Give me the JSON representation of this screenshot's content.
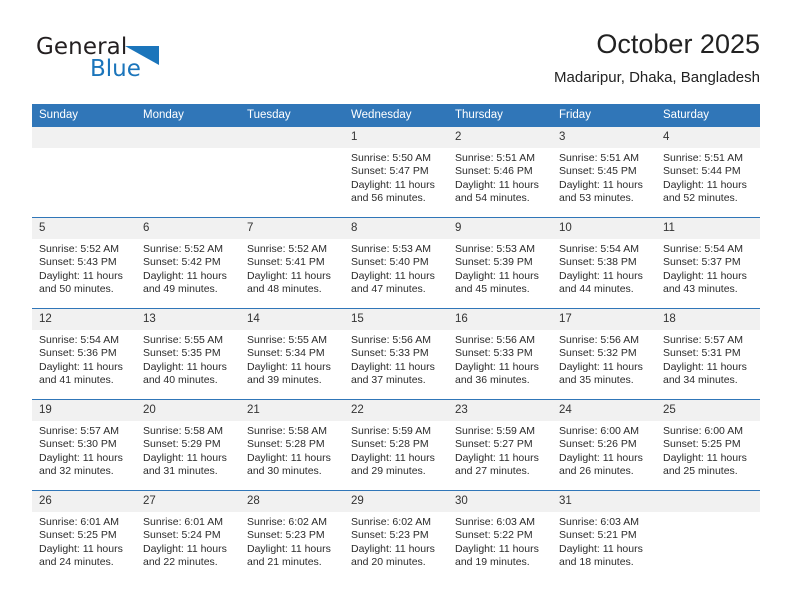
{
  "brand": {
    "name_part1": "General",
    "name_part2": "Blue",
    "triangle_color": "#1b75bb"
  },
  "header": {
    "title": "October 2025",
    "subtitle": "Madaripur, Dhaka, Bangladesh"
  },
  "theme": {
    "header_blue": "#3076b8",
    "daynum_band": "#f1f1f1",
    "text": "#2b2b2b"
  },
  "labels": {
    "sunrise_prefix": "Sunrise:",
    "sunset_prefix": "Sunset:",
    "daylight_prefix": "Daylight:"
  },
  "weekdays": [
    "Sunday",
    "Monday",
    "Tuesday",
    "Wednesday",
    "Thursday",
    "Friday",
    "Saturday"
  ],
  "weeks": [
    [
      {
        "day": "",
        "sunrise": "",
        "sunset": "",
        "daylight_line1": "",
        "daylight_line2": "",
        "empty": true
      },
      {
        "day": "",
        "sunrise": "",
        "sunset": "",
        "daylight_line1": "",
        "daylight_line2": "",
        "empty": true
      },
      {
        "day": "",
        "sunrise": "",
        "sunset": "",
        "daylight_line1": "",
        "daylight_line2": "",
        "empty": true
      },
      {
        "day": "1",
        "sunrise": "Sunrise: 5:50 AM",
        "sunset": "Sunset: 5:47 PM",
        "daylight_line1": "Daylight: 11 hours",
        "daylight_line2": "and 56 minutes."
      },
      {
        "day": "2",
        "sunrise": "Sunrise: 5:51 AM",
        "sunset": "Sunset: 5:46 PM",
        "daylight_line1": "Daylight: 11 hours",
        "daylight_line2": "and 54 minutes."
      },
      {
        "day": "3",
        "sunrise": "Sunrise: 5:51 AM",
        "sunset": "Sunset: 5:45 PM",
        "daylight_line1": "Daylight: 11 hours",
        "daylight_line2": "and 53 minutes."
      },
      {
        "day": "4",
        "sunrise": "Sunrise: 5:51 AM",
        "sunset": "Sunset: 5:44 PM",
        "daylight_line1": "Daylight: 11 hours",
        "daylight_line2": "and 52 minutes."
      }
    ],
    [
      {
        "day": "5",
        "sunrise": "Sunrise: 5:52 AM",
        "sunset": "Sunset: 5:43 PM",
        "daylight_line1": "Daylight: 11 hours",
        "daylight_line2": "and 50 minutes."
      },
      {
        "day": "6",
        "sunrise": "Sunrise: 5:52 AM",
        "sunset": "Sunset: 5:42 PM",
        "daylight_line1": "Daylight: 11 hours",
        "daylight_line2": "and 49 minutes."
      },
      {
        "day": "7",
        "sunrise": "Sunrise: 5:52 AM",
        "sunset": "Sunset: 5:41 PM",
        "daylight_line1": "Daylight: 11 hours",
        "daylight_line2": "and 48 minutes."
      },
      {
        "day": "8",
        "sunrise": "Sunrise: 5:53 AM",
        "sunset": "Sunset: 5:40 PM",
        "daylight_line1": "Daylight: 11 hours",
        "daylight_line2": "and 47 minutes."
      },
      {
        "day": "9",
        "sunrise": "Sunrise: 5:53 AM",
        "sunset": "Sunset: 5:39 PM",
        "daylight_line1": "Daylight: 11 hours",
        "daylight_line2": "and 45 minutes."
      },
      {
        "day": "10",
        "sunrise": "Sunrise: 5:54 AM",
        "sunset": "Sunset: 5:38 PM",
        "daylight_line1": "Daylight: 11 hours",
        "daylight_line2": "and 44 minutes."
      },
      {
        "day": "11",
        "sunrise": "Sunrise: 5:54 AM",
        "sunset": "Sunset: 5:37 PM",
        "daylight_line1": "Daylight: 11 hours",
        "daylight_line2": "and 43 minutes."
      }
    ],
    [
      {
        "day": "12",
        "sunrise": "Sunrise: 5:54 AM",
        "sunset": "Sunset: 5:36 PM",
        "daylight_line1": "Daylight: 11 hours",
        "daylight_line2": "and 41 minutes."
      },
      {
        "day": "13",
        "sunrise": "Sunrise: 5:55 AM",
        "sunset": "Sunset: 5:35 PM",
        "daylight_line1": "Daylight: 11 hours",
        "daylight_line2": "and 40 minutes."
      },
      {
        "day": "14",
        "sunrise": "Sunrise: 5:55 AM",
        "sunset": "Sunset: 5:34 PM",
        "daylight_line1": "Daylight: 11 hours",
        "daylight_line2": "and 39 minutes."
      },
      {
        "day": "15",
        "sunrise": "Sunrise: 5:56 AM",
        "sunset": "Sunset: 5:33 PM",
        "daylight_line1": "Daylight: 11 hours",
        "daylight_line2": "and 37 minutes."
      },
      {
        "day": "16",
        "sunrise": "Sunrise: 5:56 AM",
        "sunset": "Sunset: 5:33 PM",
        "daylight_line1": "Daylight: 11 hours",
        "daylight_line2": "and 36 minutes."
      },
      {
        "day": "17",
        "sunrise": "Sunrise: 5:56 AM",
        "sunset": "Sunset: 5:32 PM",
        "daylight_line1": "Daylight: 11 hours",
        "daylight_line2": "and 35 minutes."
      },
      {
        "day": "18",
        "sunrise": "Sunrise: 5:57 AM",
        "sunset": "Sunset: 5:31 PM",
        "daylight_line1": "Daylight: 11 hours",
        "daylight_line2": "and 34 minutes."
      }
    ],
    [
      {
        "day": "19",
        "sunrise": "Sunrise: 5:57 AM",
        "sunset": "Sunset: 5:30 PM",
        "daylight_line1": "Daylight: 11 hours",
        "daylight_line2": "and 32 minutes."
      },
      {
        "day": "20",
        "sunrise": "Sunrise: 5:58 AM",
        "sunset": "Sunset: 5:29 PM",
        "daylight_line1": "Daylight: 11 hours",
        "daylight_line2": "and 31 minutes."
      },
      {
        "day": "21",
        "sunrise": "Sunrise: 5:58 AM",
        "sunset": "Sunset: 5:28 PM",
        "daylight_line1": "Daylight: 11 hours",
        "daylight_line2": "and 30 minutes."
      },
      {
        "day": "22",
        "sunrise": "Sunrise: 5:59 AM",
        "sunset": "Sunset: 5:28 PM",
        "daylight_line1": "Daylight: 11 hours",
        "daylight_line2": "and 29 minutes."
      },
      {
        "day": "23",
        "sunrise": "Sunrise: 5:59 AM",
        "sunset": "Sunset: 5:27 PM",
        "daylight_line1": "Daylight: 11 hours",
        "daylight_line2": "and 27 minutes."
      },
      {
        "day": "24",
        "sunrise": "Sunrise: 6:00 AM",
        "sunset": "Sunset: 5:26 PM",
        "daylight_line1": "Daylight: 11 hours",
        "daylight_line2": "and 26 minutes."
      },
      {
        "day": "25",
        "sunrise": "Sunrise: 6:00 AM",
        "sunset": "Sunset: 5:25 PM",
        "daylight_line1": "Daylight: 11 hours",
        "daylight_line2": "and 25 minutes."
      }
    ],
    [
      {
        "day": "26",
        "sunrise": "Sunrise: 6:01 AM",
        "sunset": "Sunset: 5:25 PM",
        "daylight_line1": "Daylight: 11 hours",
        "daylight_line2": "and 24 minutes."
      },
      {
        "day": "27",
        "sunrise": "Sunrise: 6:01 AM",
        "sunset": "Sunset: 5:24 PM",
        "daylight_line1": "Daylight: 11 hours",
        "daylight_line2": "and 22 minutes."
      },
      {
        "day": "28",
        "sunrise": "Sunrise: 6:02 AM",
        "sunset": "Sunset: 5:23 PM",
        "daylight_line1": "Daylight: 11 hours",
        "daylight_line2": "and 21 minutes."
      },
      {
        "day": "29",
        "sunrise": "Sunrise: 6:02 AM",
        "sunset": "Sunset: 5:23 PM",
        "daylight_line1": "Daylight: 11 hours",
        "daylight_line2": "and 20 minutes."
      },
      {
        "day": "30",
        "sunrise": "Sunrise: 6:03 AM",
        "sunset": "Sunset: 5:22 PM",
        "daylight_line1": "Daylight: 11 hours",
        "daylight_line2": "and 19 minutes."
      },
      {
        "day": "31",
        "sunrise": "Sunrise: 6:03 AM",
        "sunset": "Sunset: 5:21 PM",
        "daylight_line1": "Daylight: 11 hours",
        "daylight_line2": "and 18 minutes."
      },
      {
        "day": "",
        "sunrise": "",
        "sunset": "",
        "daylight_line1": "",
        "daylight_line2": "",
        "empty": true
      }
    ]
  ]
}
